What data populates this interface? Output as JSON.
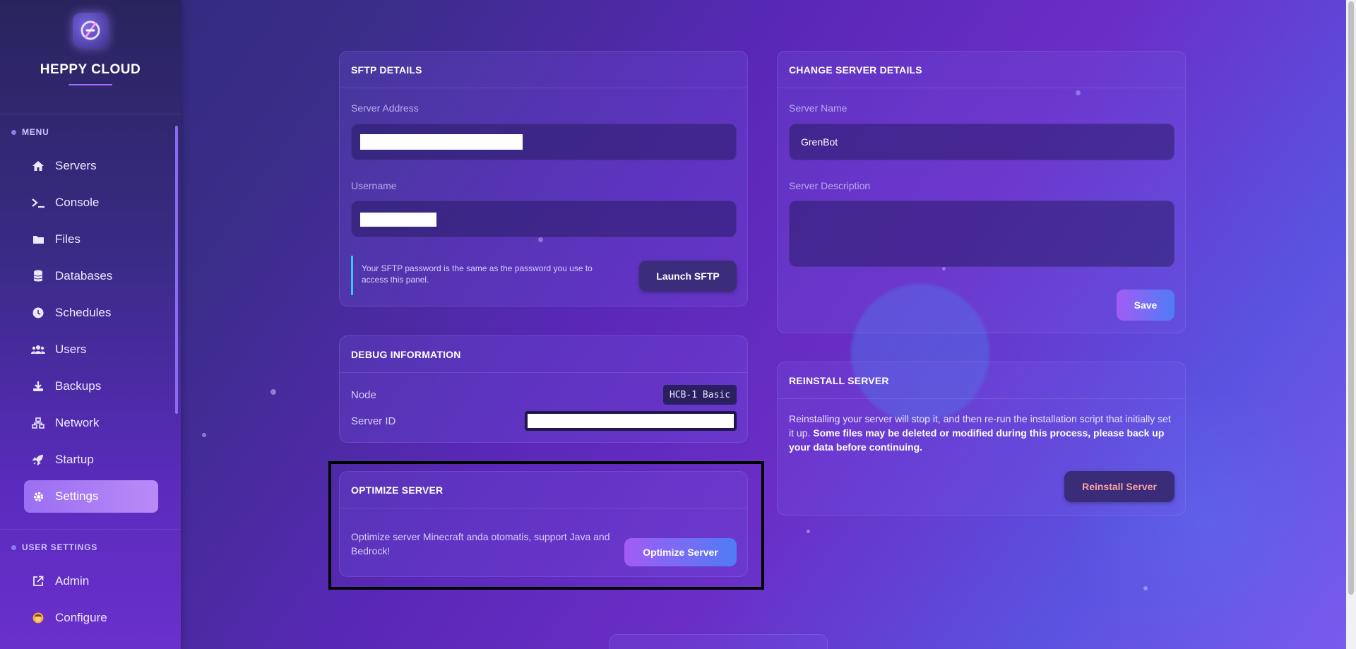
{
  "brand": {
    "name": "HEPPY CLOUD"
  },
  "sidebar": {
    "menu_title": "MENU",
    "items": [
      {
        "label": "Servers",
        "icon": "home-icon"
      },
      {
        "label": "Console",
        "icon": "terminal-icon"
      },
      {
        "label": "Files",
        "icon": "folder-icon"
      },
      {
        "label": "Databases",
        "icon": "database-icon"
      },
      {
        "label": "Schedules",
        "icon": "clock-icon"
      },
      {
        "label": "Users",
        "icon": "users-icon"
      },
      {
        "label": "Backups",
        "icon": "download-icon"
      },
      {
        "label": "Network",
        "icon": "network-icon"
      },
      {
        "label": "Startup",
        "icon": "rocket-icon"
      },
      {
        "label": "Settings",
        "icon": "gear-icon",
        "active": true
      }
    ],
    "user_settings_title": "USER SETTINGS",
    "user_items": [
      {
        "label": "Admin",
        "icon": "external-link-icon"
      },
      {
        "label": "Configure",
        "icon": "user-avatar-icon"
      }
    ]
  },
  "sftp": {
    "title": "SFTP DETAILS",
    "server_address_label": "Server Address",
    "username_label": "Username",
    "note": "Your SFTP password is the same as the password you use to access this panel.",
    "launch_button": "Launch SFTP"
  },
  "change_details": {
    "title": "CHANGE SERVER DETAILS",
    "server_name_label": "Server Name",
    "server_name_value": "GrenBot",
    "server_description_label": "Server Description",
    "server_description_value": "",
    "save_button": "Save"
  },
  "debug": {
    "title": "DEBUG INFORMATION",
    "node_label": "Node",
    "node_value": "HCB-1 Basic",
    "server_id_label": "Server ID"
  },
  "reinstall": {
    "title": "REINSTALL SERVER",
    "text_normal": "Reinstalling your server will stop it, and then re-run the installation script that initially set it up. ",
    "text_bold": "Some files may be deleted or modified during this process, please back up your data before continuing.",
    "button": "Reinstall Server"
  },
  "optimize": {
    "title": "OPTIMIZE SERVER",
    "text": "Optimize server Minecraft anda otomatis, support Java and Bedrock!",
    "button": "Optimize Server"
  },
  "colors": {
    "accent": "#a16dff",
    "danger_text": "#f9a3a3",
    "note_border": "#38c6f0"
  }
}
